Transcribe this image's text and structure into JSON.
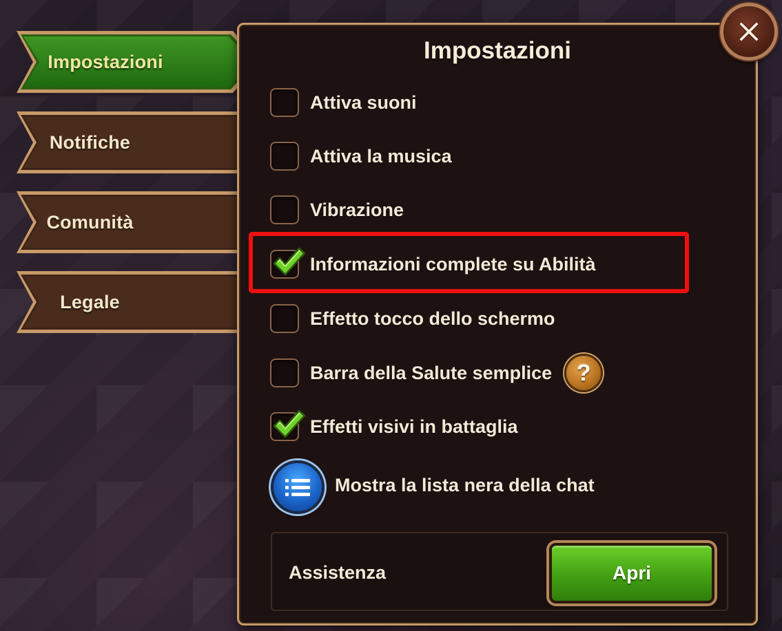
{
  "tabs": [
    {
      "label": "Impostazioni",
      "active": true
    },
    {
      "label": "Notifiche",
      "active": false
    },
    {
      "label": "Comunità",
      "active": false
    },
    {
      "label": "Legale",
      "active": false
    }
  ],
  "panel": {
    "title": "Impostazioni"
  },
  "options": [
    {
      "label": "Attiva suoni",
      "checked": false
    },
    {
      "label": "Attiva la musica",
      "checked": false
    },
    {
      "label": "Vibrazione",
      "checked": false
    },
    {
      "label": "Informazioni complete su Abilità",
      "checked": true,
      "highlighted": true
    },
    {
      "label": "Effetto tocco dello schermo",
      "checked": false
    },
    {
      "label": "Barra della Salute semplice",
      "checked": false,
      "help_icon": "question-mark-icon"
    },
    {
      "label": "Effetti visivi in battaglia",
      "checked": true
    }
  ],
  "help": {
    "glyph": "?"
  },
  "chat_blacklist": {
    "label": "Mostra la lista nera della chat",
    "icon": "list-icon"
  },
  "support": {
    "label": "Assistenza",
    "button_label": "Apri"
  },
  "close": {
    "icon": "close-icon"
  },
  "colors": {
    "panel_bg": "#1d1211",
    "panel_border": "#c79a69",
    "active_tab": "#2f7d18",
    "inactive_tab": "#3e2418",
    "checkmark": "#6fd12c",
    "highlight": "#ee1010",
    "apri_button": "#46a414",
    "list_button": "#1a63c8"
  }
}
